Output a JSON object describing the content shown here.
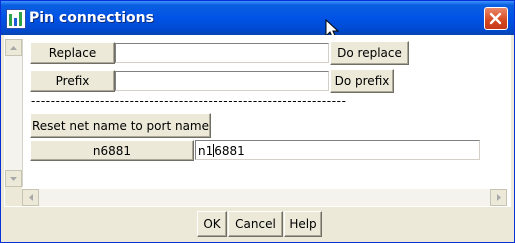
{
  "window": {
    "title": "Pin connections"
  },
  "replace": {
    "button_label": "Replace",
    "value": "",
    "action_label": "Do replace"
  },
  "prefix": {
    "button_label": "Prefix",
    "value": "",
    "action_label": "Do prefix"
  },
  "separator": "----------------------------------------------------------------",
  "reset_button_label": "Reset net name to port name",
  "pin": {
    "port_name": "n6881",
    "net_name_before_caret": "n1",
    "net_name_after_caret": "6881"
  },
  "dialog_buttons": {
    "ok": "OK",
    "cancel": "Cancel",
    "help": "Help"
  },
  "colors": {
    "titlebar": "#0053e6",
    "close": "#d5481f",
    "face": "#ece9d8"
  }
}
